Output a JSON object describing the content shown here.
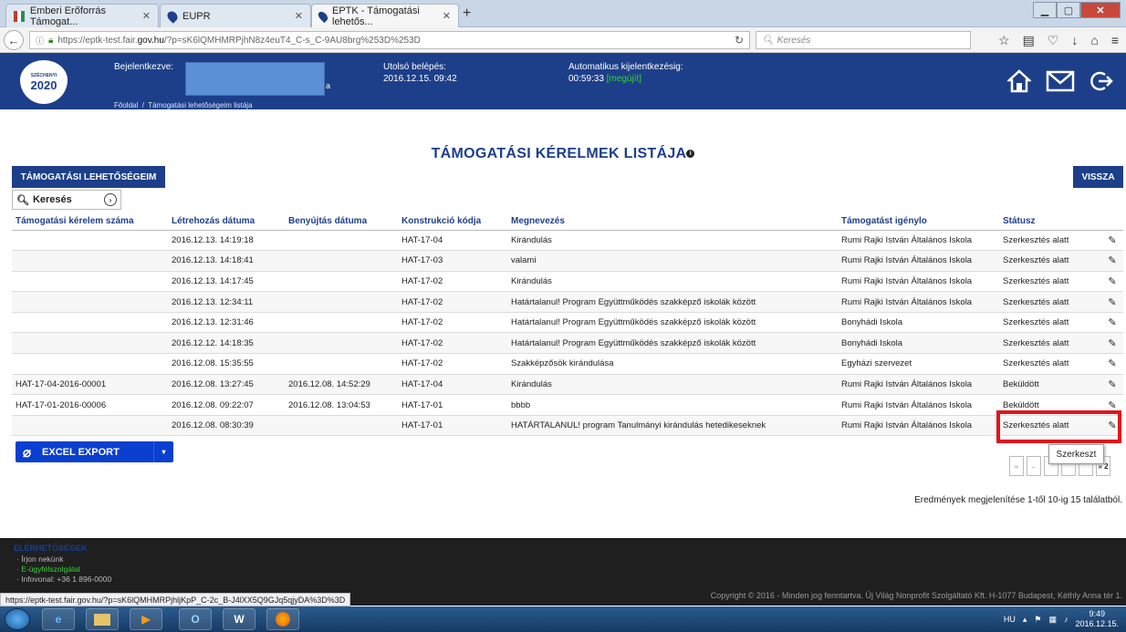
{
  "browser": {
    "tabs": [
      {
        "title": "Emberi Erőforrás Támogat...",
        "active": false
      },
      {
        "title": "EUPR",
        "active": false
      },
      {
        "title": "EPTK - Támogatási lehetős...",
        "active": true
      }
    ],
    "new_tab": "+",
    "url_prefix": "https://eptk-test.fair.",
    "url_host": "gov.hu",
    "url_rest": "/?p=sK6lQMHMRPjhN8z4euT4_C-s_C-9AU8brg%253D%253D",
    "search_placeholder": "Keresés",
    "status_url": "https://eptk-test.fair.gov.hu/?p=sK6lQMHMRPjhljKpP_C-2c_B-J4lXX5Q9GJq5qjyDA%3D%3D"
  },
  "header": {
    "logo_year": "2020",
    "logo_text": "SZÉCHENYI",
    "logged_in_label": "Bejelentkezve:",
    "logged_in_suffix": "a",
    "last_login_label": "Utolsó belépés:",
    "last_login_value": "2016.12.15. 09:42",
    "auto_logout_label": "Automatikus kijelentkezésig:",
    "auto_logout_value": "00:59:33",
    "renew": "[megújít]",
    "breadcrumb_home": "Főoldal",
    "breadcrumb_sep": "/",
    "breadcrumb_current": "Támogatási lehetőségeim listája"
  },
  "page": {
    "title": "TÁMOGATÁSI KÉRELMEK LISTÁJA",
    "info_glyph": "i",
    "opportunities_button": "TÁMOGATÁSI LEHETŐSÉGEIM",
    "back_button": "VISSZA",
    "search_label": "Keresés",
    "export_label": "EXCEL EXPORT",
    "tooltip": "Szerkeszt",
    "results_text": "Eredmények megjelenítése 1-től 10-ig 15 találatból."
  },
  "table": {
    "headers": [
      "Támogatási kérelem száma",
      "Létrehozás dátuma",
      "Benyújtás dátuma",
      "Konstrukció kódja",
      "Megnevezés",
      "Támogatást igénylo",
      "Státusz",
      ""
    ],
    "rows": [
      [
        "",
        "2016.12.13. 14:19:18",
        "",
        "HAT-17-04",
        "Kirándulás",
        "Rumi Rajki István Általános Iskola",
        "Szerkesztés alatt"
      ],
      [
        "",
        "2016.12.13. 14:18:41",
        "",
        "HAT-17-03",
        "valami",
        "Rumi Rajki István Általános Iskola",
        "Szerkesztés alatt"
      ],
      [
        "",
        "2016.12.13. 14:17:45",
        "",
        "HAT-17-02",
        "Kirándulás",
        "Rumi Rajki István Általános Iskola",
        "Szerkesztés alatt"
      ],
      [
        "",
        "2016.12.13. 12:34:11",
        "",
        "HAT-17-02",
        "Határtalanul! Program Együttműködés szakképző iskolák között",
        "Rumi Rajki István Általános Iskola",
        "Szerkesztés alatt"
      ],
      [
        "",
        "2016.12.13. 12:31:46",
        "",
        "HAT-17-02",
        "Határtalanul! Program Együttműködés szakképző iskolák között",
        "Bonyhádi Iskola",
        "Szerkesztés alatt"
      ],
      [
        "",
        "2016.12.12. 14:18:35",
        "",
        "HAT-17-02",
        "Határtalanul! Program Együttműködés szakképző iskolák között",
        "Bonyhádi Iskola",
        "Szerkesztés alatt"
      ],
      [
        "",
        "2016.12.08. 15:35:55",
        "",
        "HAT-17-02",
        "Szakképzősök kirándulása",
        "Egyházi szervezet",
        "Szerkesztés alatt"
      ],
      [
        "HAT-17-04-2016-00001",
        "2016.12.08. 13:27:45",
        "2016.12.08. 14:52:29",
        "HAT-17-04",
        "Kirándulás",
        "Rumi Rajki István Általános Iskola",
        "Beküldött"
      ],
      [
        "HAT-17-01-2016-00006",
        "2016.12.08. 09:22:07",
        "2016.12.08. 13:04:53",
        "HAT-17-01",
        "bbbb",
        "Rumi Rajki István Általános Iskola",
        "Beküldött"
      ],
      [
        "",
        "2016.12.08. 08:30:39",
        "",
        "HAT-17-01",
        "HATÁRTALANUL! program Tanulmányi kirándulás hetedikeseknek",
        "Rumi Rajki István Általános Iskola",
        "Szerkesztés alatt"
      ]
    ]
  },
  "pager": {
    "first": "«",
    "prev": "←",
    "last": "» 2"
  },
  "footer": {
    "heading": "ELÉRHETŐSÉGEK",
    "links": [
      "Írjon nekünk",
      "E-ügyfélszolgálat",
      "Infovonal: +36 1 896-0000"
    ],
    "copyright": "Copyright © 2016 - Minden jog fenntartva. Új Világ Nonprofit Szolgáltató Kft. H-1077 Budapest, Kéthly Anna tér 1."
  },
  "taskbar": {
    "lang": "HU",
    "time": "9:49",
    "date": "2016.12.15."
  },
  "colors": {
    "brand": "#1d3f8a",
    "highlight": "#e0141b",
    "export": "#0b3fd0"
  },
  "icons": [
    "home-icon",
    "mail-icon",
    "logout-icon",
    "edit-icon",
    "search-icon",
    "paperclip-icon"
  ]
}
